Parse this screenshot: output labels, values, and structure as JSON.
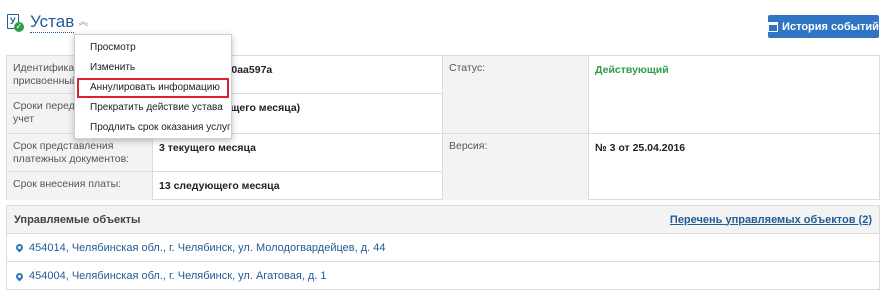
{
  "header": {
    "icon": "document-check-icon",
    "title": "Устав",
    "collapse_icon": "chevron-up-double-icon"
  },
  "history_button": {
    "icon": "calendar-icon",
    "label": "История событий"
  },
  "info": {
    "identifier_label": "Идентификатор присвоенный С",
    "identifier_value": "f31-875f-2a1870aa597a",
    "deadlines_label": "Сроки передачи приборов учет",
    "deadlines_value": "яца) - 25 (текущего месяца)",
    "payment_docs_label": "Срок представления платежных документов:",
    "payment_docs_value": "3 текущего месяца",
    "payment_label": "Срок внесения платы:",
    "payment_value": "13 следующего месяца",
    "status_label": "Статус:",
    "status_value": "Действующий",
    "version_label": "Версия:",
    "version_value": "№ 3 от 25.04.2016"
  },
  "objects": {
    "title": "Управляемые объекты",
    "link": "Перечень управляемых объектов (2)",
    "rows": [
      {
        "icon": "map-pin-icon",
        "address": "454014, Челябинская обл., г. Челябинск, ул. Молодогвардейцев, д. 44"
      },
      {
        "icon": "map-pin-icon",
        "address": "454004, Челябинская обл., г. Челябинск, ул. Агатовая, д. 1"
      }
    ]
  },
  "menu": {
    "items": [
      {
        "label": "Просмотр"
      },
      {
        "label": "Изменить"
      },
      {
        "label": "Аннулировать информацию"
      },
      {
        "label": "Прекратить действие устава"
      },
      {
        "label": "Продлить срок оказания услуг"
      }
    ],
    "highlight_color": "#d9232d"
  },
  "colors": {
    "accent": "#2f75c4",
    "link": "#1f5c99",
    "status_active": "#2e9e44"
  }
}
